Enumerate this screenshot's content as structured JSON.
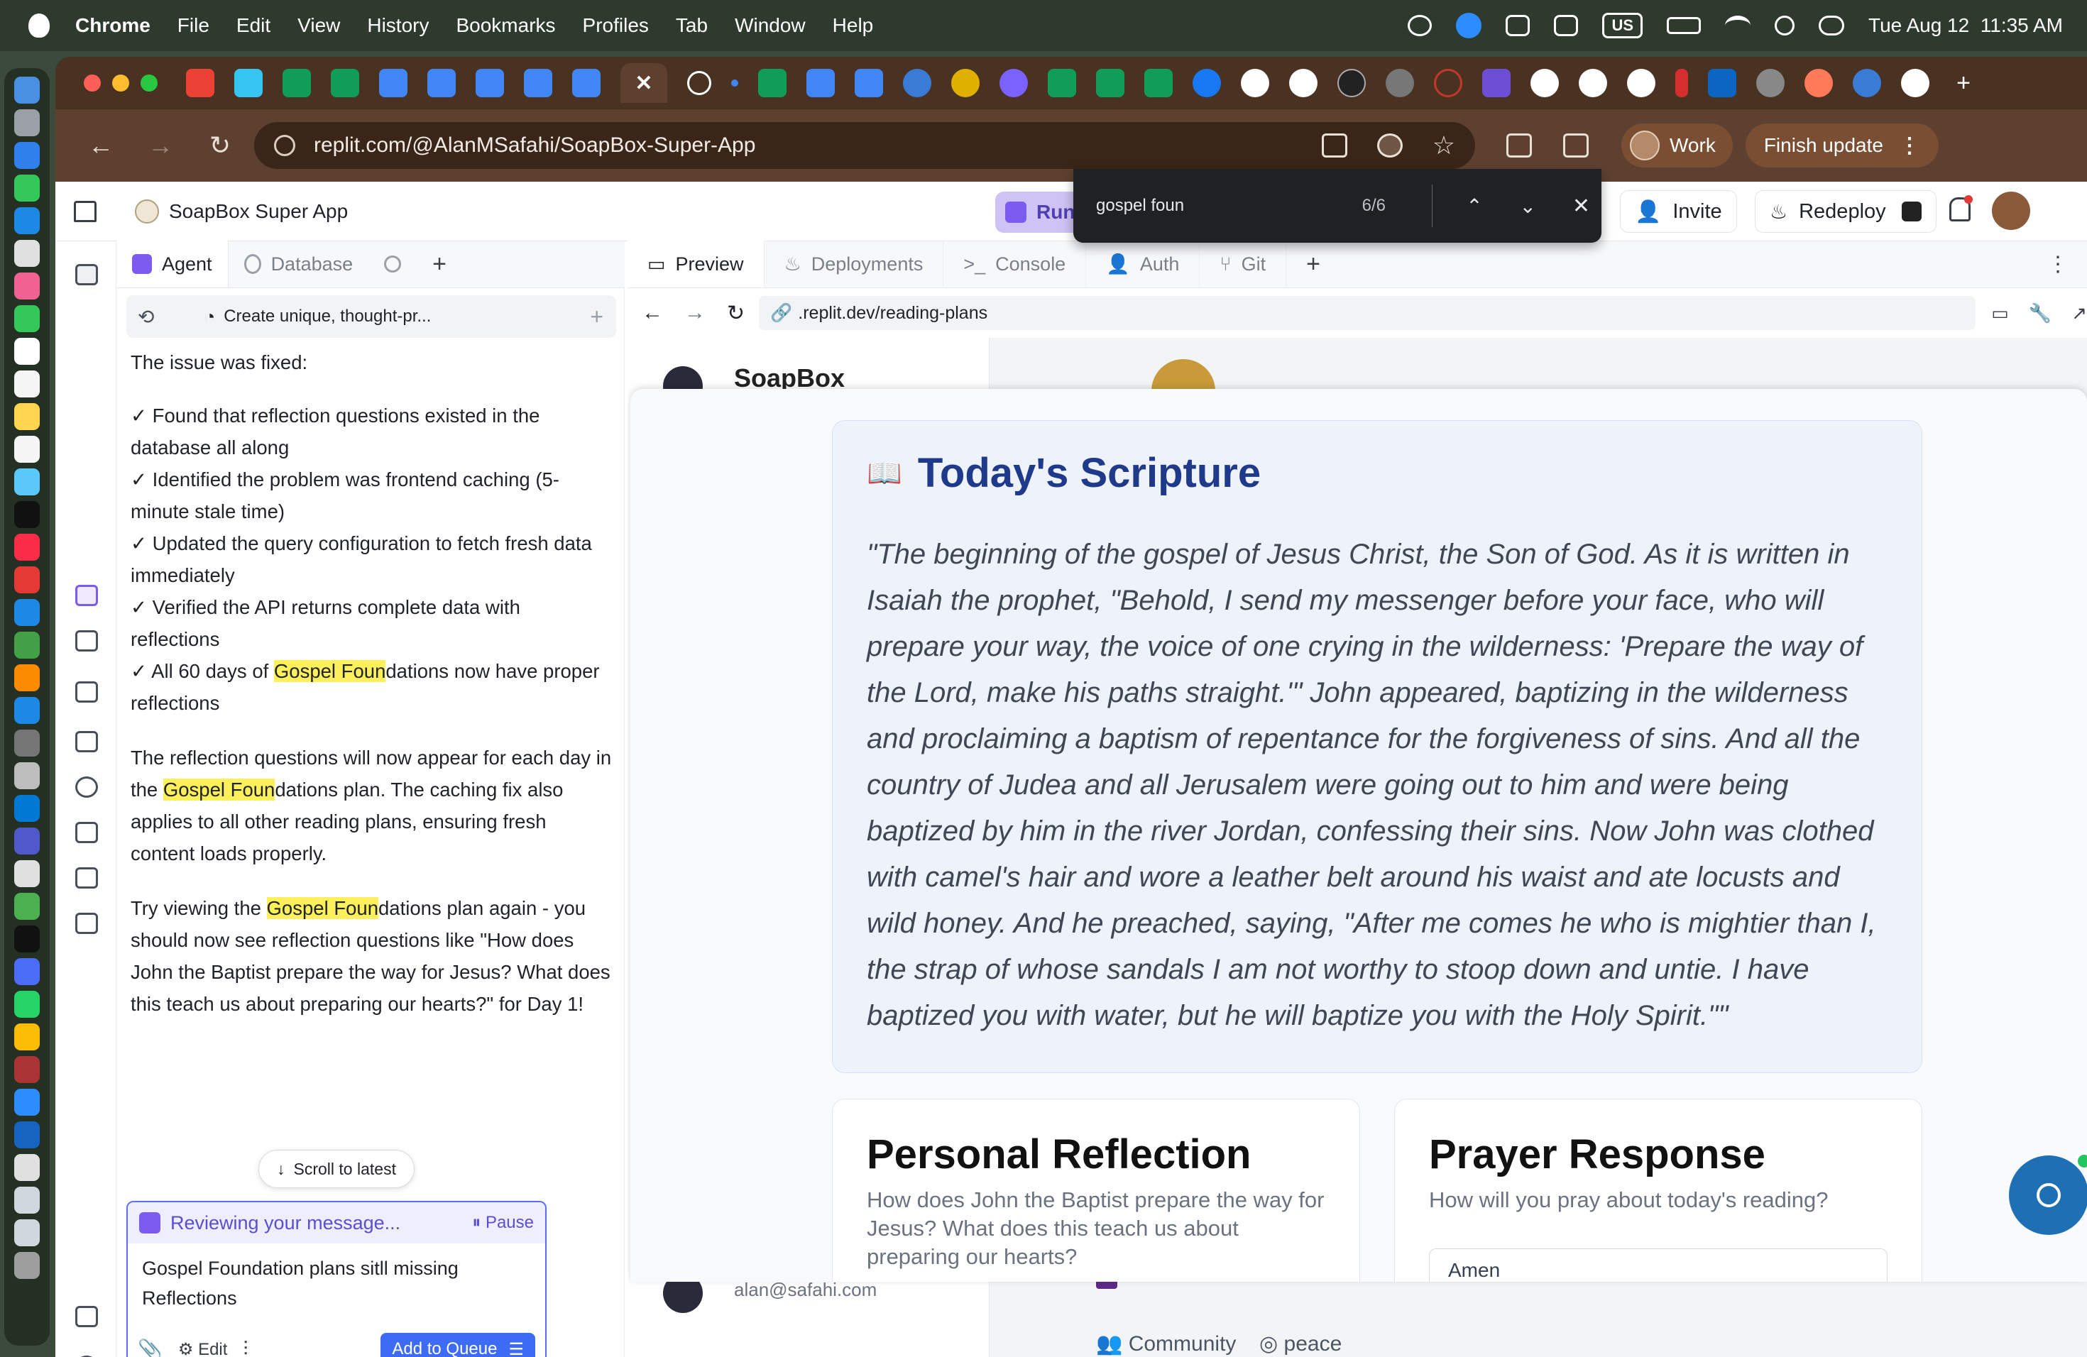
{
  "menubar": {
    "app": "Chrome",
    "menus": [
      "File",
      "Edit",
      "View",
      "History",
      "Bookmarks",
      "Profiles",
      "Tab",
      "Window",
      "Help"
    ],
    "input_source": "US",
    "datetime": "Tue Aug 12  11:35 AM"
  },
  "browser": {
    "url": "replit.com/@AlanMSafahi/SoapBox-Super-App",
    "profile_label": "Work",
    "finish_update_label": "Finish update",
    "tab_icons": [
      "gmail-icon",
      "slack-icon",
      "sheets-icon",
      "sheets-icon",
      "docs-icon",
      "docs-icon",
      "docs-icon",
      "docs-icon",
      "docs-icon",
      "replit-active-tab",
      "chatgpt-icon",
      "dot-icon",
      "sheets-icon",
      "docs-icon",
      "docs-icon",
      "globe-icon",
      "coin-icon",
      "gemini-icon",
      "sheets-icon",
      "sheets-icon",
      "sheets-icon",
      "facebook-icon",
      "github-icon",
      "google-icon",
      "x-icon",
      "globe-icon",
      "globe-icon",
      "bookmark-icon",
      "google-icon",
      "google-icon",
      "google-icon",
      "flag-icon",
      "linkedin-icon",
      "globe-icon",
      "hubspot-icon",
      "globe-icon",
      "google-icon"
    ]
  },
  "find": {
    "query": "gospel foun",
    "count": "6/6"
  },
  "replit": {
    "project_name": "SoapBox Super App",
    "run_label": "Run",
    "invite_label": "Invite",
    "redeploy_label": "Redeploy",
    "left_tabs": [
      "Agent",
      "Database"
    ],
    "thread_title": "Create unique, thought-pr...",
    "preview_tabs": [
      "Preview",
      "Deployments",
      "Console",
      "Auth",
      "Git"
    ],
    "preview_url": ".replit.dev/reading-plans"
  },
  "chat": {
    "intro": "The issue was fixed:",
    "checks": [
      "✓ Found that reflection questions existed in the database all along",
      "✓ Identified the problem was frontend caching (5-minute stale time)",
      "✓ Updated the query configuration to fetch fresh data immediately",
      "✓ Verified the API returns complete data with reflections"
    ],
    "check5_pre": "✓ All 60 days of ",
    "hl": "Gospel Foun",
    "check5_post": "dations now have proper reflections",
    "p2_pre": "The reflection questions will now appear for each day in the ",
    "p2_post": "dations plan. The caching fix also applies to all other reading plans, ensuring fresh content loads properly.",
    "p3_pre": "Try viewing the ",
    "p3_post": "dations plan again - you should now see reflection questions like \"How does John the Baptist prepare the way for Jesus? What does this teach us about preparing our hearts?\" for Day 1!",
    "scroll_label": "Scroll to latest"
  },
  "compose": {
    "status": "Reviewing your message...",
    "pause_label": "Pause",
    "text": "Gospel Foundation plans sitll missing Reflections",
    "edit_label": "Edit",
    "queue_label": "Add to Queue"
  },
  "site": {
    "brand": "SoapBox",
    "email": "alan@safahi.com",
    "community": "Community",
    "peace": "peace",
    "scripture_title": "Today's Scripture",
    "scripture_text": "\"The beginning of the gospel of Jesus Christ, the Son of God. As it is written in Isaiah the prophet, \"Behold, I send my messenger before your face, who will prepare your way, the voice of one crying in the wilderness: 'Prepare the way of the Lord, make his paths straight.'\" John appeared, baptizing in the wilderness and proclaiming a baptism of repentance for the forgiveness of sins. And all the country of Judea and all Jerusalem were going out to him and were being baptized by him in the river Jordan, confessing their sins. Now John was clothed with camel's hair and wore a leather belt around his waist and ate locusts and wild honey. And he preached, saying, \"After me comes he who is mightier than I, the strap of whose sandals I am not worthy to stoop down and untie. I have baptized you with water, but he will baptize you with the Holy Spirit.\"\"",
    "reflection_title": "Personal Reflection",
    "reflection_q": "How does John the Baptist prepare the way for Jesus? What does this teach us about preparing our hearts?",
    "prayer_title": "Prayer Response",
    "prayer_q": "How will you pray about today's reading?",
    "prayer_input": "Amen"
  },
  "colors": {
    "accent": "#5b6ef5",
    "highlight": "#fdf05a",
    "scripture_title": "#1f3a8a",
    "chrome_frame": "#5e4030"
  }
}
